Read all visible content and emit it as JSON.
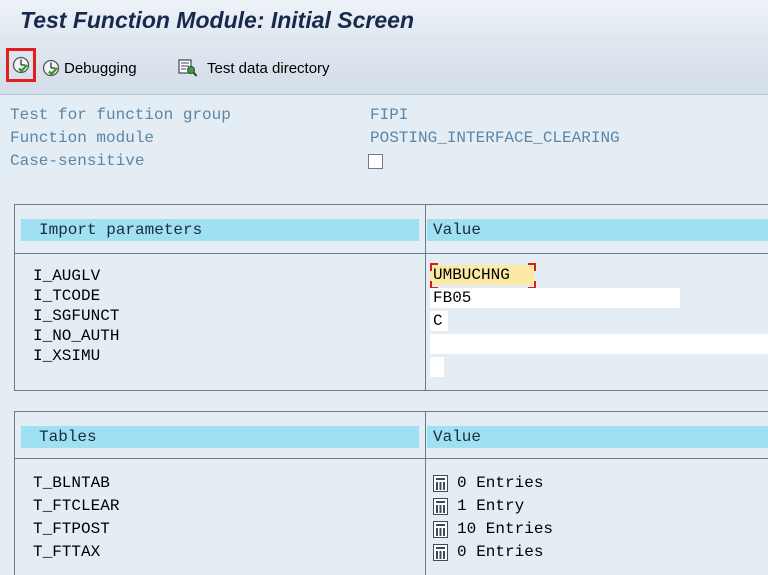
{
  "window": {
    "title": "Test Function Module: Initial Screen"
  },
  "toolbar": {
    "execute_icon": "execute-icon",
    "debugging_label": "Debugging",
    "test_data_directory_label": "Test data directory"
  },
  "header": {
    "function_group_label": "Test for function group",
    "function_group_value": "FIPI",
    "function_module_label": "Function module",
    "function_module_value": "POSTING_INTERFACE_CLEARING",
    "case_sensitive_label": "Case-sensitive",
    "case_sensitive_checked": false
  },
  "import_parameters": {
    "column_name": "Import parameters",
    "column_value": "Value",
    "rows": [
      {
        "name": "I_AUGLV",
        "value": "UMBUCHNG"
      },
      {
        "name": "I_TCODE",
        "value": "FB05"
      },
      {
        "name": "I_SGFUNCT",
        "value": "C"
      },
      {
        "name": "I_NO_AUTH",
        "value": ""
      },
      {
        "name": "I_XSIMU",
        "value": ""
      }
    ]
  },
  "tables": {
    "column_name": "Tables",
    "column_value": "Value",
    "rows": [
      {
        "name": "T_BLNTAB",
        "value": "0 Entries"
      },
      {
        "name": "T_FTCLEAR",
        "value": "1 Entry"
      },
      {
        "name": "T_FTPOST",
        "value": "10 Entries"
      },
      {
        "name": "T_FTTAX",
        "value": "0 Entries"
      }
    ]
  },
  "colors": {
    "background": "#e4ecf4",
    "title": "#17294c",
    "column_header": "#9fe0f2",
    "label_text": "#5b86a6",
    "focus_field": "#fde9a6",
    "highlight_border": "#e02020"
  }
}
